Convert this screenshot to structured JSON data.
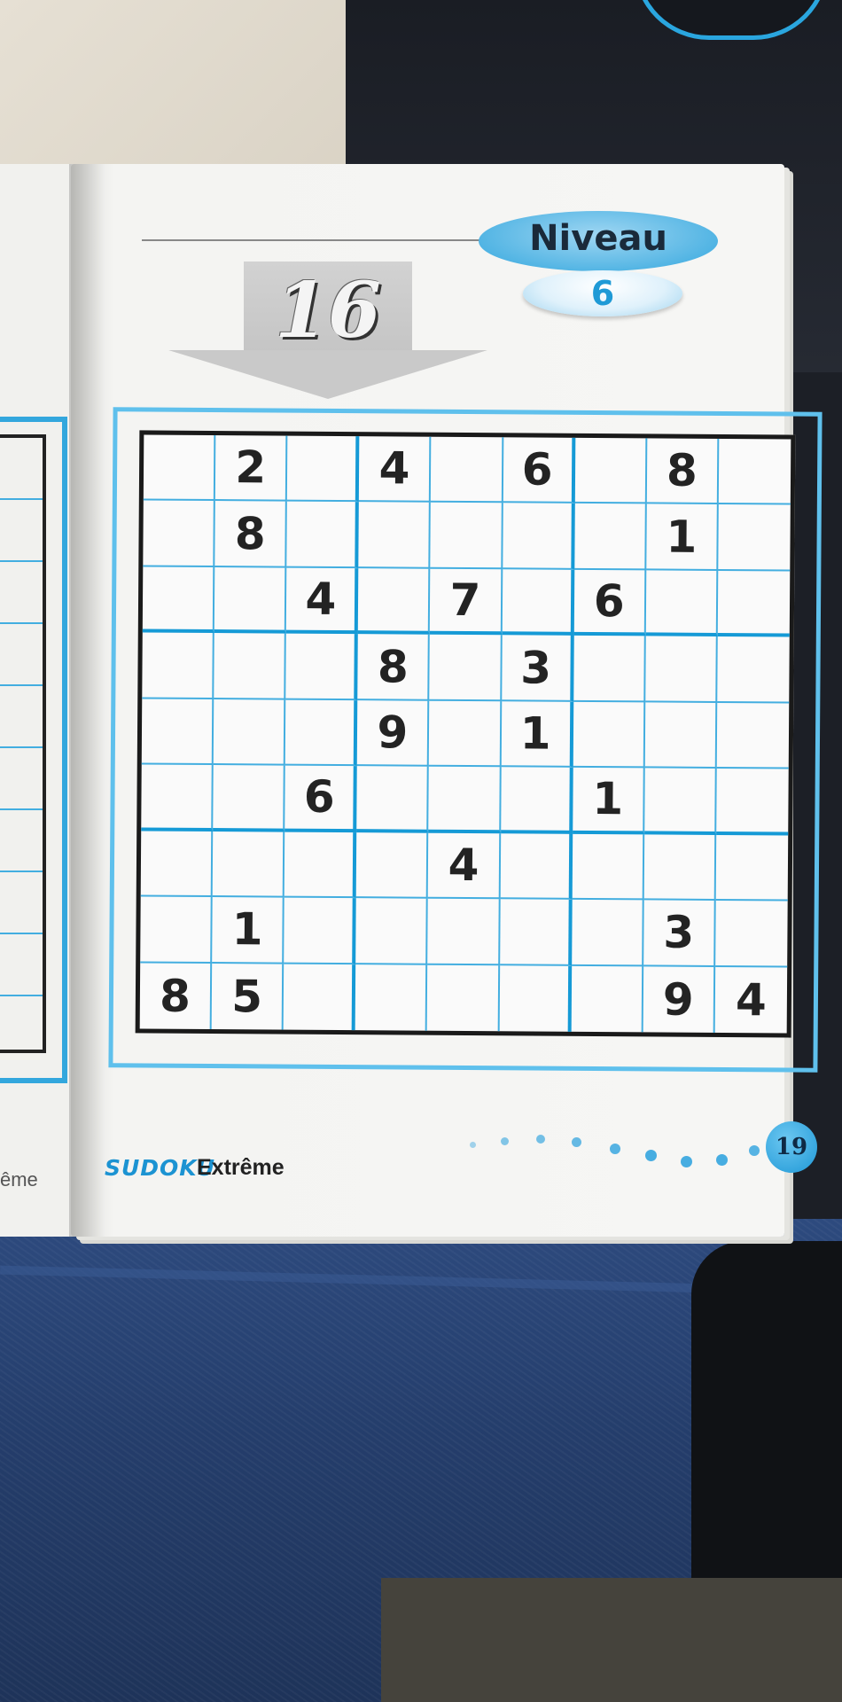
{
  "puzzle": {
    "number": "16",
    "level_label": "Niveau",
    "level_value": "6",
    "grid": [
      [
        "",
        "2",
        "",
        "4",
        "",
        "6",
        "",
        "8",
        ""
      ],
      [
        "",
        "8",
        "",
        "",
        "",
        "",
        "",
        "1",
        ""
      ],
      [
        "",
        "",
        "4",
        "",
        "7",
        "",
        "6",
        "",
        ""
      ],
      [
        "",
        "",
        "",
        "8",
        "",
        "3",
        "",
        "",
        ""
      ],
      [
        "",
        "",
        "",
        "9",
        "",
        "1",
        "",
        "",
        ""
      ],
      [
        "",
        "",
        "6",
        "",
        "",
        "",
        "1",
        "",
        ""
      ],
      [
        "",
        "",
        "",
        "",
        "4",
        "",
        "",
        "",
        ""
      ],
      [
        "",
        "1",
        "",
        "",
        "",
        "",
        "",
        "3",
        ""
      ],
      [
        "8",
        "5",
        "",
        "",
        "",
        "",
        "",
        "9",
        "4"
      ]
    ]
  },
  "footer": {
    "brand": "SUDOKU",
    "subtitle": "Extrême",
    "page_number": "19"
  },
  "left_page": {
    "text_fragment": "ême"
  },
  "colors": {
    "accent_blue": "#1f98d6",
    "grid_line": "#43aee0"
  }
}
